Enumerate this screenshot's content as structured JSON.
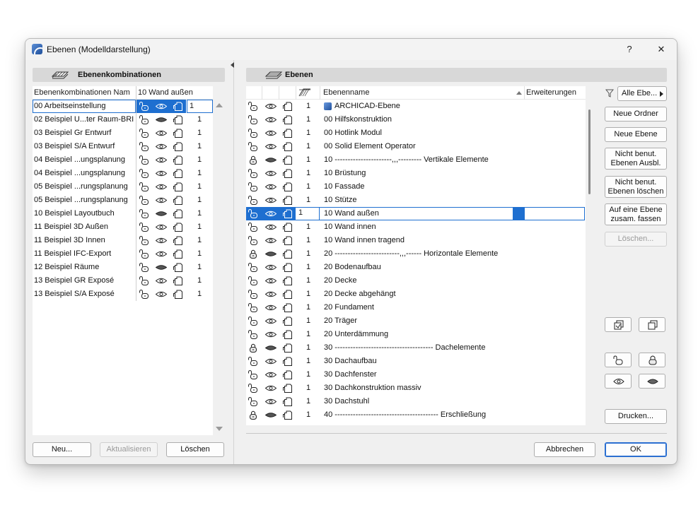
{
  "window": {
    "title": "Ebenen (Modelldarstellung)",
    "help": "?",
    "close": "✕"
  },
  "left": {
    "header": "Ebenenkombinationen",
    "col_name": "Ebenenkombinationen Nam",
    "col_current": "10 Wand außen",
    "edit_value": "1",
    "items": [
      {
        "name": "00 Arbeitseinstellung",
        "num": "1",
        "eye": "open",
        "lock": "open"
      },
      {
        "name": "02 Beispiel U...ter Raum-BRI",
        "num": "1",
        "eye": "closed",
        "lock": "open"
      },
      {
        "name": "03 Beispiel Gr Entwurf",
        "num": "1",
        "eye": "open",
        "lock": "open"
      },
      {
        "name": "03 Beispiel S/A Entwurf",
        "num": "1",
        "eye": "open",
        "lock": "open"
      },
      {
        "name": "04 Beispiel ...ungsplanung",
        "num": "1",
        "eye": "open",
        "lock": "open"
      },
      {
        "name": "04 Beispiel ...ungsplanung",
        "num": "1",
        "eye": "open",
        "lock": "open"
      },
      {
        "name": "05 Beispiel ...rungsplanung",
        "num": "1",
        "eye": "open",
        "lock": "open"
      },
      {
        "name": "05 Beispiel ...rungsplanung",
        "num": "1",
        "eye": "open",
        "lock": "open"
      },
      {
        "name": "10 Beispiel Layoutbuch",
        "num": "1",
        "eye": "closed",
        "lock": "open"
      },
      {
        "name": "11 Beispiel 3D Außen",
        "num": "1",
        "eye": "open",
        "lock": "open"
      },
      {
        "name": "11 Beispiel 3D Innen",
        "num": "1",
        "eye": "open",
        "lock": "open"
      },
      {
        "name": "11 Beispiel IFC-Export",
        "num": "1",
        "eye": "open",
        "lock": "open"
      },
      {
        "name": "12 Beispiel Räume",
        "num": "1",
        "eye": "closed",
        "lock": "open"
      },
      {
        "name": "13 Beispiel GR Exposé",
        "num": "1",
        "eye": "open",
        "lock": "open"
      },
      {
        "name": "13 Beispiel S/A Exposé",
        "num": "1",
        "eye": "open",
        "lock": "open"
      }
    ],
    "buttons": {
      "new": "Neu...",
      "update": "Aktualisieren",
      "delete": "Löschen"
    }
  },
  "right": {
    "header": "Ebenen",
    "col_name": "Ebenenname",
    "col_ext": "Erweiterungen",
    "filter_label": "Alle Ebe...",
    "edit_value": "1",
    "selected_index": 8,
    "layers": [
      {
        "name": "ARCHICAD-Ebene",
        "num": "1",
        "eye": "open",
        "lock": "open",
        "special": true
      },
      {
        "name": "00 Hilfskonstruktion",
        "num": "1",
        "eye": "open",
        "lock": "open"
      },
      {
        "name": "00 Hotlink Modul",
        "num": "1",
        "eye": "open",
        "lock": "open"
      },
      {
        "name": "00 Solid Element Operator",
        "num": "1",
        "eye": "open",
        "lock": "open"
      },
      {
        "name": "10 ----------------------,,,--------- Vertikale Elemente",
        "num": "1",
        "eye": "closed",
        "lock": "closed"
      },
      {
        "name": "10 Brüstung",
        "num": "1",
        "eye": "open",
        "lock": "open"
      },
      {
        "name": "10 Fassade",
        "num": "1",
        "eye": "open",
        "lock": "open"
      },
      {
        "name": "10 Stütze",
        "num": "1",
        "eye": "open",
        "lock": "open"
      },
      {
        "name": "10 Wand außen",
        "num": "1",
        "eye": "open",
        "lock": "open"
      },
      {
        "name": "10 Wand innen",
        "num": "1",
        "eye": "open",
        "lock": "open"
      },
      {
        "name": "10 Wand innen tragend",
        "num": "1",
        "eye": "open",
        "lock": "open"
      },
      {
        "name": "20 -------------------------,,,------ Horizontale Elemente",
        "num": "1",
        "eye": "closed",
        "lock": "closed"
      },
      {
        "name": "20 Bodenaufbau",
        "num": "1",
        "eye": "open",
        "lock": "open"
      },
      {
        "name": "20 Decke",
        "num": "1",
        "eye": "open",
        "lock": "open"
      },
      {
        "name": "20 Decke abgehängt",
        "num": "1",
        "eye": "open",
        "lock": "open"
      },
      {
        "name": "20 Fundament",
        "num": "1",
        "eye": "open",
        "lock": "open"
      },
      {
        "name": "20 Träger",
        "num": "1",
        "eye": "open",
        "lock": "open"
      },
      {
        "name": "20 Unterdämmung",
        "num": "1",
        "eye": "open",
        "lock": "open"
      },
      {
        "name": "30 -------------------------------------- Dachelemente",
        "num": "1",
        "eye": "closed",
        "lock": "closed"
      },
      {
        "name": "30 Dachaufbau",
        "num": "1",
        "eye": "open",
        "lock": "open"
      },
      {
        "name": "30 Dachfenster",
        "num": "1",
        "eye": "open",
        "lock": "open"
      },
      {
        "name": "30 Dachkonstruktion massiv",
        "num": "1",
        "eye": "open",
        "lock": "open"
      },
      {
        "name": "30 Dachstuhl",
        "num": "1",
        "eye": "open",
        "lock": "open"
      },
      {
        "name": "40 ---------------------------------------- Erschließung",
        "num": "1",
        "eye": "closed",
        "lock": "closed"
      }
    ],
    "buttons": {
      "new_folder": "Neue Ordner",
      "new_layer": "Neue Ebene",
      "hide_unused": "Nicht benut.\nEbenen Ausbl.",
      "delete_unused": "Nicht benut.\nEbenen löschen",
      "merge": "Auf eine Ebene\nzusam. fassen",
      "delete": "Löschen...",
      "print": "Drucken...",
      "cancel": "Abbrechen",
      "ok": "OK"
    }
  },
  "colors": {
    "selection": "#1e6fd0",
    "accent": "#2b6fd1"
  }
}
